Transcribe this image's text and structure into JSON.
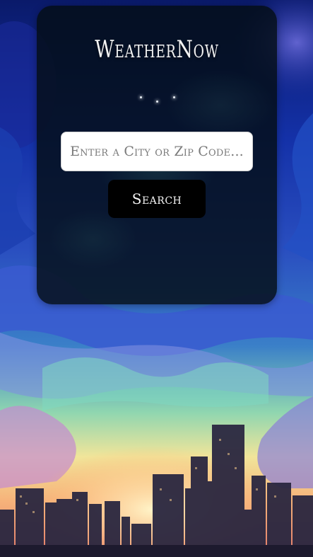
{
  "app": {
    "title": "WeatherNow"
  },
  "search": {
    "placeholder": "Enter a City or Zip Code...",
    "value": "",
    "button_label": "Search"
  },
  "colors": {
    "card_background": "#040e14",
    "button_background": "#000000",
    "input_background": "#ffffff",
    "title_text": "#f3f3f3"
  },
  "icons": {
    "sparkle": "sparkle-dots-icon"
  }
}
